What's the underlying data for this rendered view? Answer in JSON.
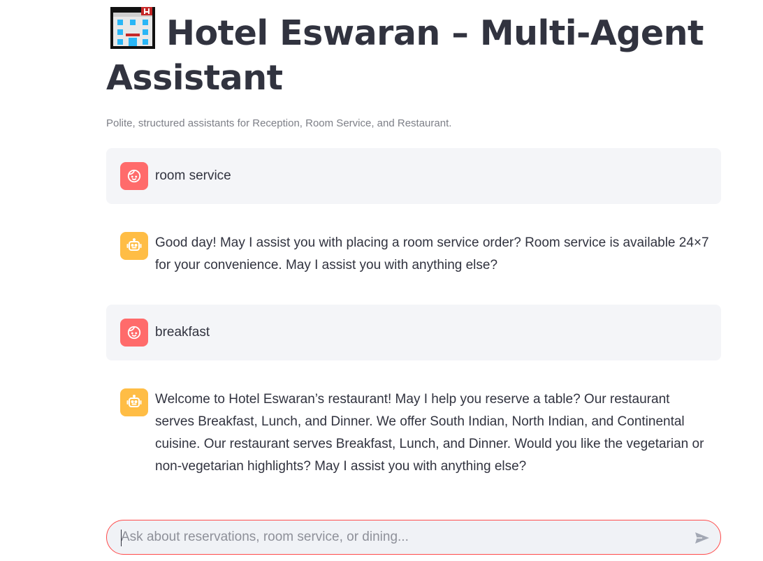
{
  "header": {
    "icon": "hotel-icon",
    "title": "Hotel Eswaran – Multi-Agent Assistant",
    "caption": "Polite, structured assistants for Reception, Room Service, and Restaurant."
  },
  "messages": [
    {
      "role": "user",
      "avatar_icon": "user-face-icon",
      "text": "room service"
    },
    {
      "role": "assistant",
      "avatar_icon": "robot-icon",
      "text": "Good day! May I assist you with placing a room service order? Room service is available 24×7 for your convenience. May I assist you with anything else?"
    },
    {
      "role": "user",
      "avatar_icon": "user-face-icon",
      "text": "breakfast"
    },
    {
      "role": "assistant",
      "avatar_icon": "robot-icon",
      "text": "Welcome to Hotel Eswaran’s restaurant! May I help you reserve a table? Our restaurant serves Breakfast, Lunch, and Dinner. We offer South Indian, North Indian, and Continental cuisine. Our restaurant serves Breakfast, Lunch, and Dinner. Would you like the vegetarian or non-vegetarian highlights? May I assist you with anything else?"
    }
  ],
  "chat_input": {
    "placeholder": "Ask about reservations, room service, or dining...",
    "value": "",
    "send_icon": "send-icon"
  },
  "colors": {
    "user_avatar": "#ff6b6b",
    "assistant_avatar": "#ffbd45",
    "user_bubble": "#f4f5f8",
    "input_border": "#ff4b4b"
  }
}
